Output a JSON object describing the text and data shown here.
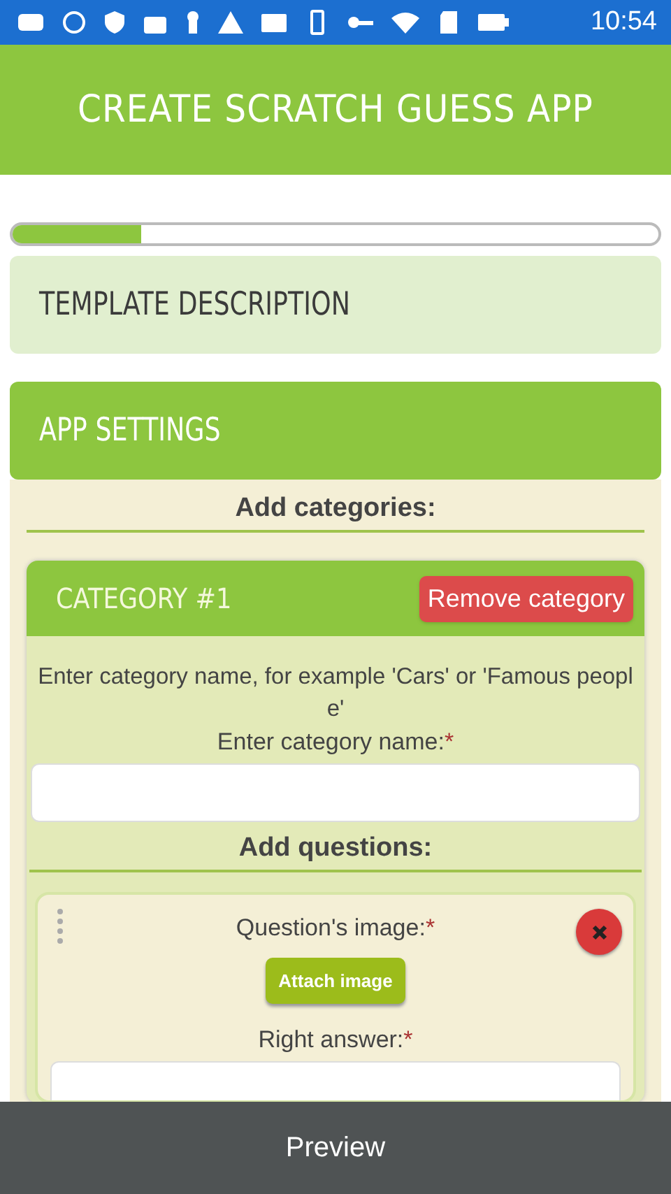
{
  "status_bar": {
    "time": "10:54"
  },
  "header": {
    "title": "CREATE SCRATCH GUESS APP"
  },
  "progress": {
    "level": 0.2
  },
  "sections": [
    {
      "title": "TEMPLATE DESCRIPTION",
      "expanded": false
    },
    {
      "title": "APP SETTINGS",
      "expanded": true
    }
  ],
  "settings": {
    "categories_heading": "Add categories:",
    "category": {
      "title": "CATEGORY #1",
      "remove_button": "Remove category",
      "hint": "Enter category name, for example 'Cars' or 'Famous people'",
      "name_label": "Enter category name:",
      "required_mark": "*",
      "questions_heading": "Add questions:",
      "question": {
        "image_label": "Question's image:",
        "image_required_mark": "*",
        "attach_button": "Attach image",
        "answer_label": "Right answer:",
        "answer_required_mark": "*"
      }
    }
  },
  "bottom_bar": {
    "button": "Preview"
  }
}
